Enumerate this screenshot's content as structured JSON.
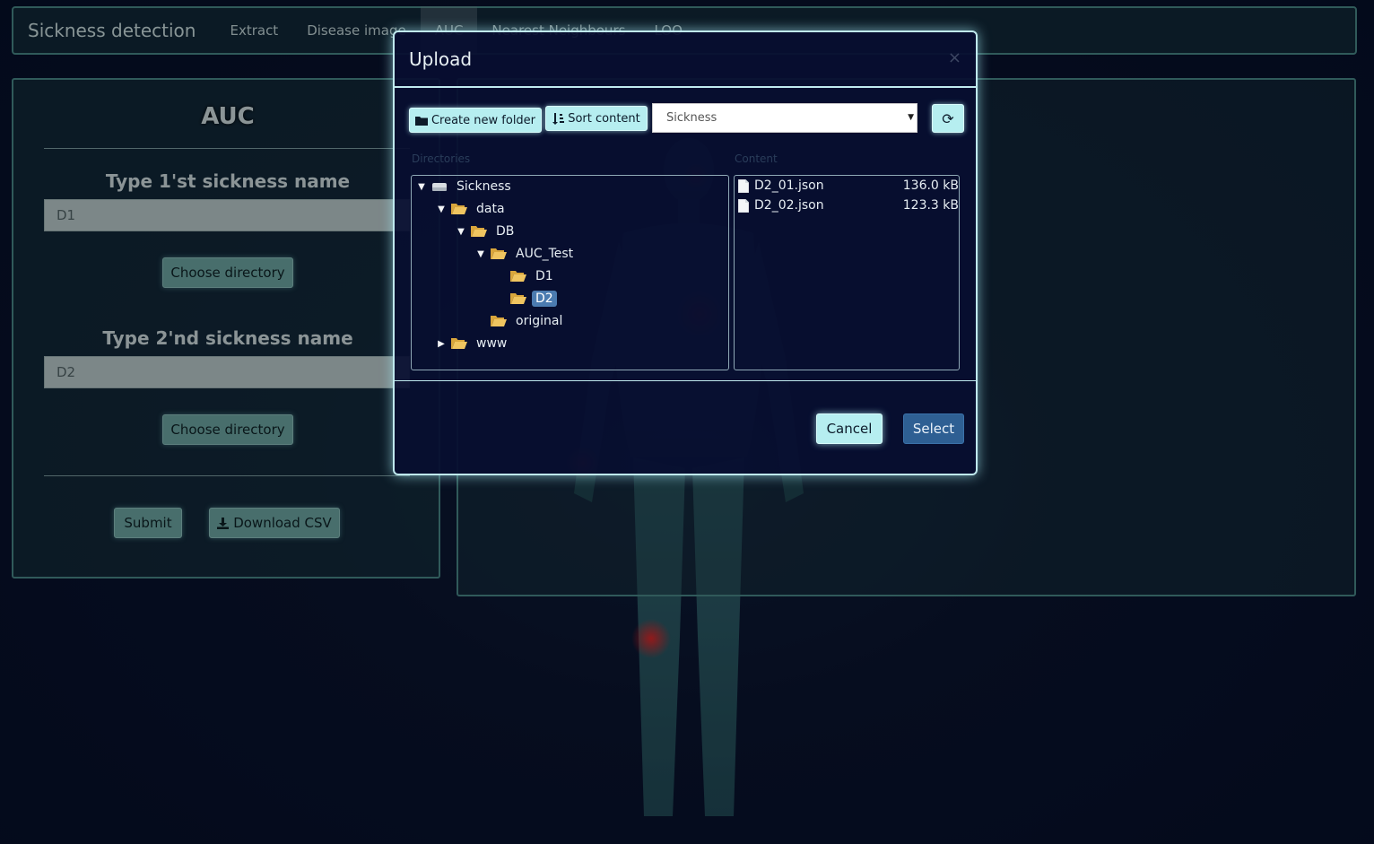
{
  "navbar": {
    "brand": "Sickness detection",
    "items": [
      {
        "label": "Extract",
        "active": false
      },
      {
        "label": "Disease image",
        "active": false
      },
      {
        "label": "AUC",
        "active": true
      },
      {
        "label": "Nearest Neighbours",
        "active": false
      },
      {
        "label": "LOO",
        "active": false
      }
    ]
  },
  "auc_panel": {
    "title": "AUC",
    "label_1": "Type 1'st sickness name",
    "input_1_value": "D1",
    "choose_dir_1": "Choose directory",
    "label_2": "Type 2'nd sickness name",
    "input_2_value": "D2",
    "choose_dir_2": "Choose directory",
    "submit": "Submit",
    "download_csv": "Download CSV"
  },
  "modal": {
    "title": "Upload",
    "close_glyph": "×",
    "create_folder": "Create new folder",
    "sort_content": "Sort content",
    "root_select_value": "Sickness",
    "refresh_glyph": "⟳",
    "directories_label": "Directories",
    "content_label": "Content",
    "tree": [
      {
        "label": "Sickness",
        "expanded": true,
        "selected": false
      },
      {
        "label": "data",
        "expanded": true,
        "selected": false
      },
      {
        "label": "DB",
        "expanded": true,
        "selected": false
      },
      {
        "label": "AUC_Test",
        "expanded": true,
        "selected": false
      },
      {
        "label": "D1",
        "selected": false
      },
      {
        "label": "D2",
        "selected": true
      },
      {
        "label": "original",
        "selected": false
      },
      {
        "label": "www",
        "expanded": false,
        "selected": false
      }
    ],
    "files": [
      {
        "name": "D2_01.json",
        "size": "136.0 kB"
      },
      {
        "name": "D2_02.json",
        "size": "123.3 kB"
      }
    ],
    "cancel": "Cancel",
    "select": "Select"
  },
  "colors": {
    "panel_border": "#4a8a8a",
    "modal_border": "#bfe9ee",
    "accent_cyan": "#b6eef0",
    "select_blue": "#2e5f93",
    "selected_node": "#4b7bb0",
    "folder_yellow": "#f0c560"
  }
}
